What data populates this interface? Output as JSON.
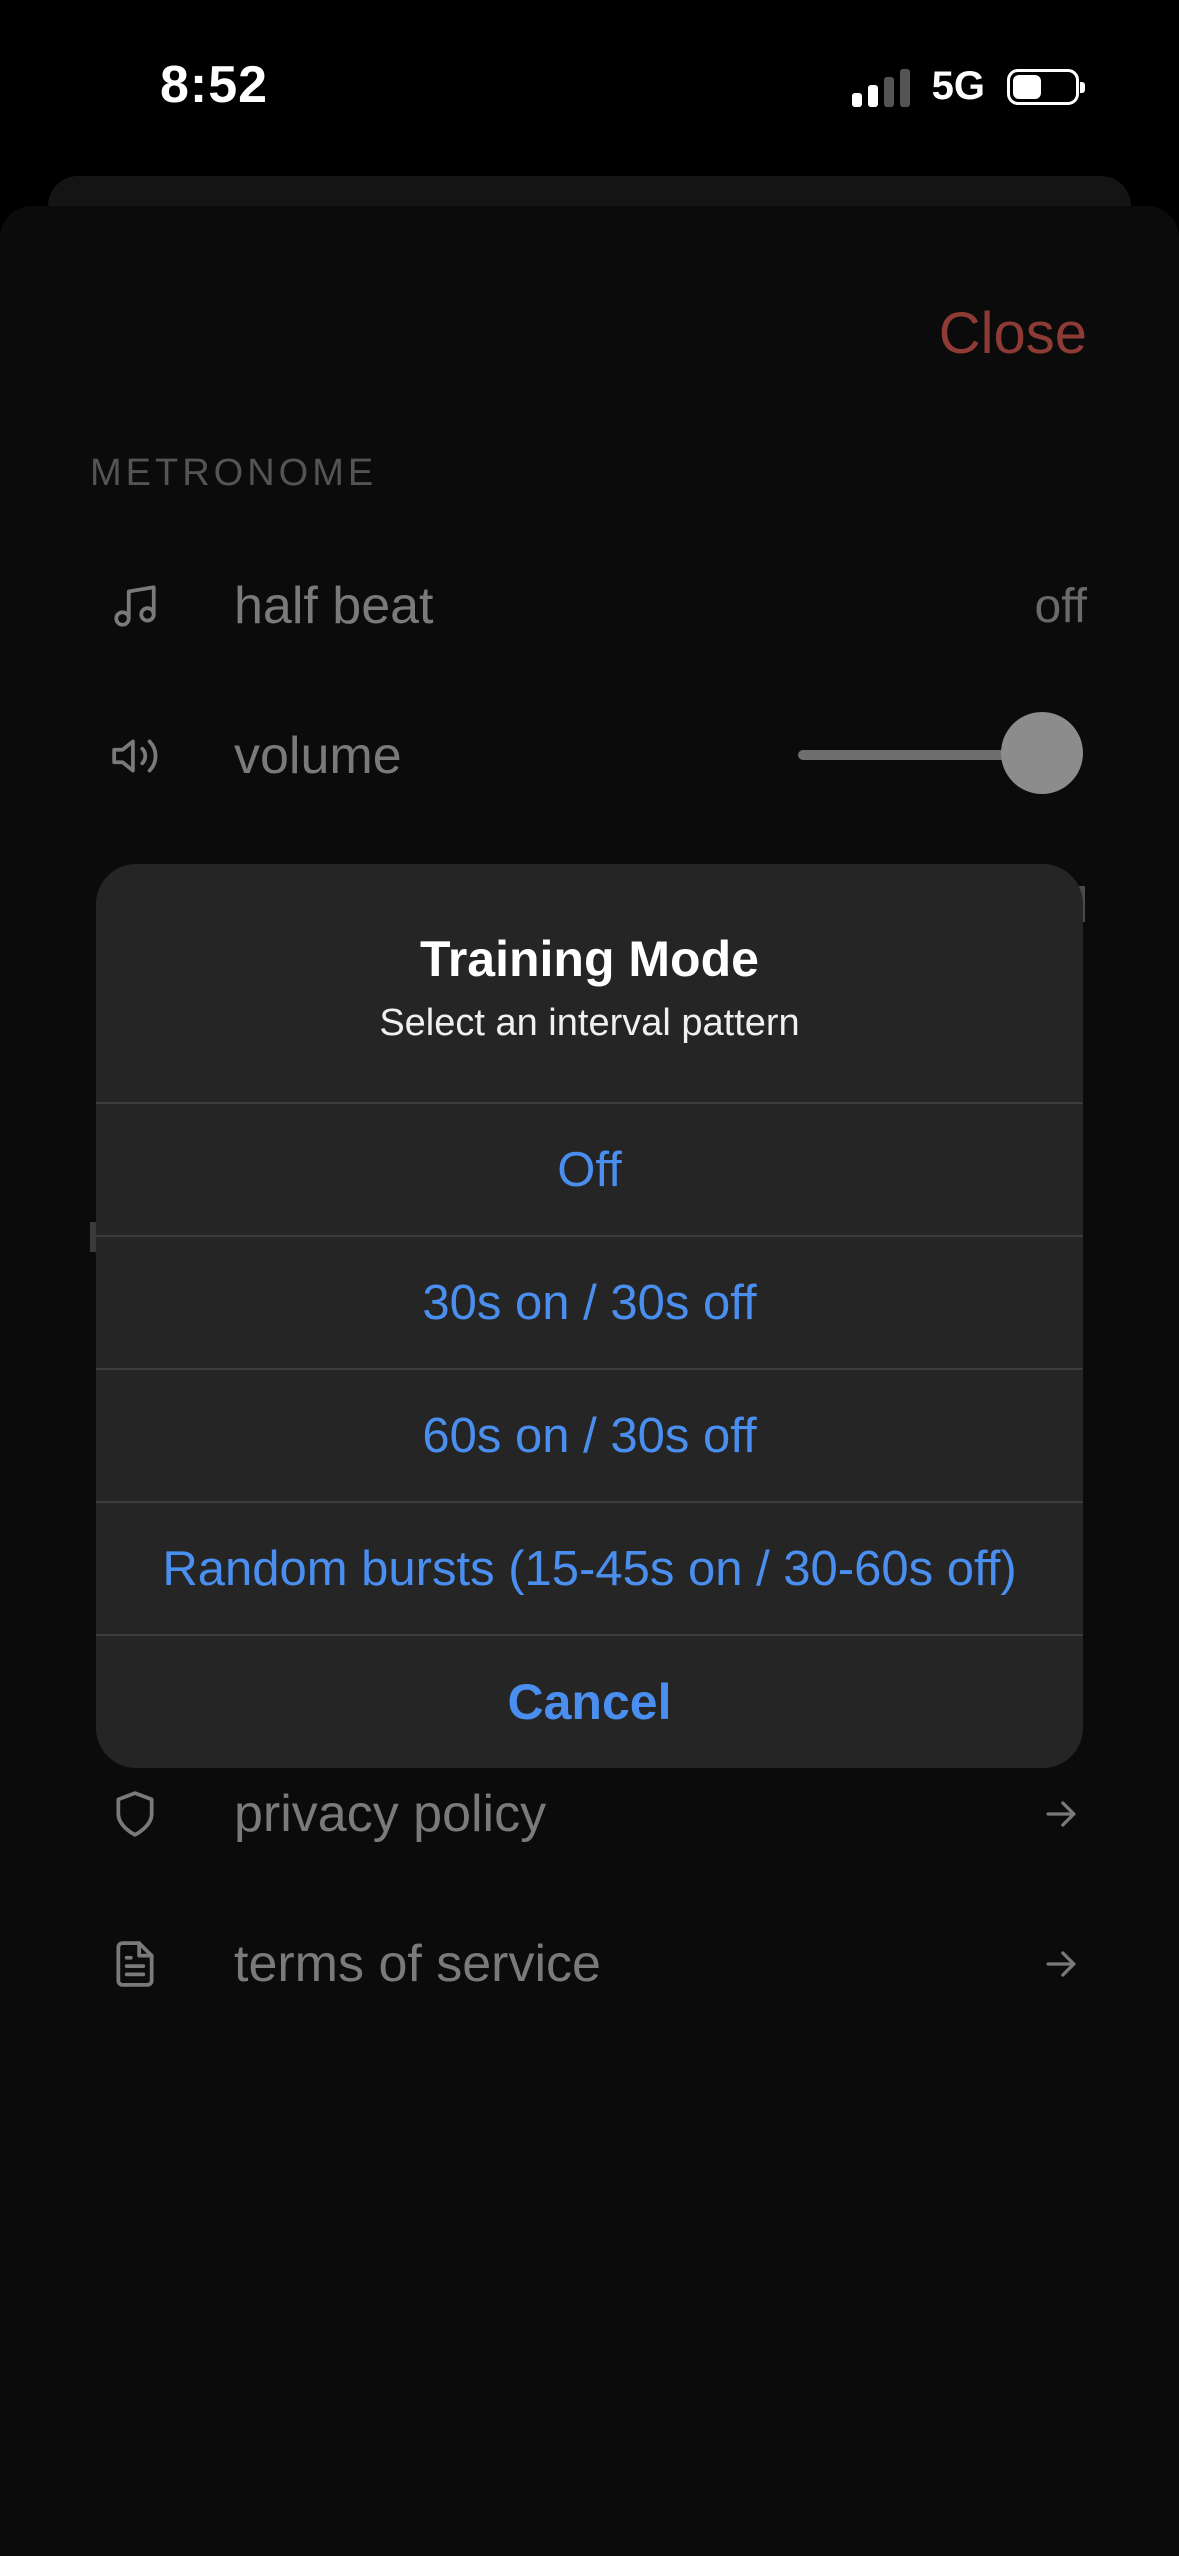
{
  "status_bar": {
    "time": "8:52",
    "network": "5G"
  },
  "settings": {
    "close_label": "Close",
    "section_metronome": "METRONOME",
    "half_beat": {
      "label": "half beat",
      "value": "off",
      "icon": "music-note-icon"
    },
    "volume": {
      "label": "volume",
      "icon": "speaker-icon",
      "level": 1.0
    },
    "privacy_policy": {
      "label": "privacy policy",
      "icon": "shield-icon"
    },
    "terms_of_service": {
      "label": "terms of service",
      "icon": "document-icon"
    }
  },
  "dialog": {
    "title": "Training Mode",
    "subtitle": "Select an interval pattern",
    "options": [
      "Off",
      "30s on / 30s off",
      "60s on / 30s off",
      "Random bursts (15-45s on / 30-60s off)"
    ],
    "cancel_label": "Cancel"
  },
  "colors": {
    "accent_blue": "#4a8ff0",
    "close_red": "#8e3b36",
    "dialog_bg": "#252525"
  }
}
